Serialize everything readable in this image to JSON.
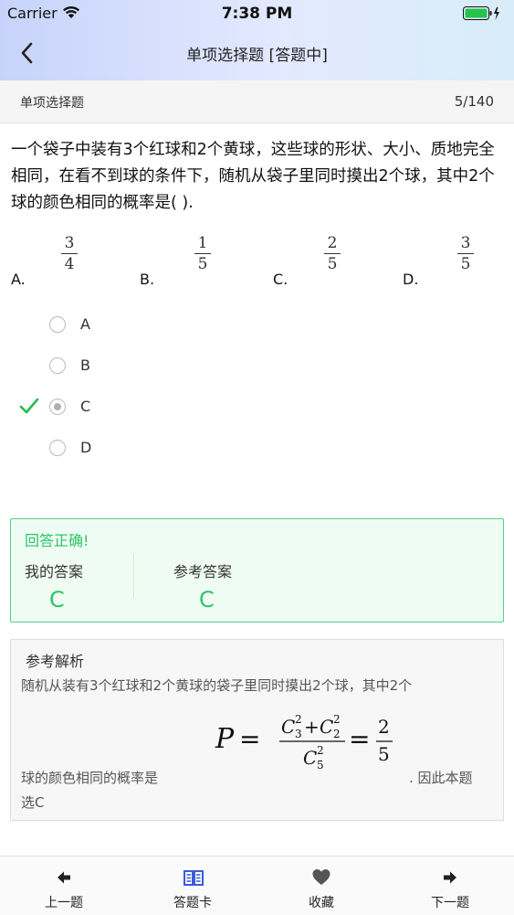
{
  "status_bar": {
    "carrier": "Carrier",
    "time": "7:38 PM"
  },
  "nav": {
    "title": "单项选择题 [答题中]"
  },
  "subheader": {
    "type": "单项选择题",
    "progress": "5/140"
  },
  "question": {
    "text": "一个袋子中装有3个红球和2个黄球，这些球的形状、大小、质地完全相同，在看不到球的条件下，随机从袋子里同时摸出2个球，其中2个球的颜色相同的概率是(   ).",
    "options": [
      {
        "label": "A.",
        "num": "3",
        "den": "4"
      },
      {
        "label": "B.",
        "num": "1",
        "den": "5"
      },
      {
        "label": "C.",
        "num": "2",
        "den": "5"
      },
      {
        "label": "D.",
        "num": "3",
        "den": "5"
      }
    ]
  },
  "choices": [
    {
      "letter": "A",
      "selected": false
    },
    {
      "letter": "B",
      "selected": false
    },
    {
      "letter": "C",
      "selected": true
    },
    {
      "letter": "D",
      "selected": false
    }
  ],
  "result": {
    "status": "回答正确!",
    "my_answer_label": "我的答案",
    "my_answer": "C",
    "ref_answer_label": "参考答案",
    "ref_answer": "C",
    "color": "#2bc46a"
  },
  "analysis": {
    "title": "参考解析",
    "line1": "随机从装有3个红球和2个黄球的袋子里同时摸出2个球，其中2个",
    "line2": "球的颜色相同的概率是",
    "line2_end": ".  因此本题",
    "line3": "选C",
    "formula": {
      "lhs": "P",
      "eq": "=",
      "numerator": [
        {
          "base": "C",
          "sup": "2",
          "sub": "3"
        },
        {
          "op": "+"
        },
        {
          "base": "C",
          "sup": "2",
          "sub": "2"
        }
      ],
      "denominator": {
        "base": "C",
        "sup": "2",
        "sub": "5"
      },
      "result_num": "2",
      "result_den": "5"
    }
  },
  "tabbar": [
    {
      "label": "上一题",
      "icon": "arrow-left-icon"
    },
    {
      "label": "答题卡",
      "icon": "book-icon",
      "color": "#3b5bdb"
    },
    {
      "label": "收藏",
      "icon": "heart-icon"
    },
    {
      "label": "下一题",
      "icon": "arrow-right-icon"
    }
  ],
  "colors": {
    "accent_green": "#2bc46a",
    "check_green": "#1fbf4a",
    "book_blue": "#3b5bdb"
  }
}
